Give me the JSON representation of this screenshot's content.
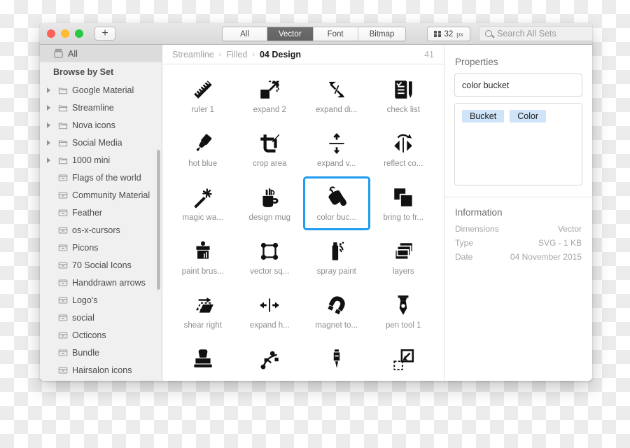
{
  "window": {
    "traffic_lights": [
      {
        "name": "close",
        "color": "#ff5f57"
      },
      {
        "name": "minimize",
        "color": "#febc2e"
      },
      {
        "name": "zoom",
        "color": "#28c840"
      }
    ],
    "add_button_label": "+"
  },
  "toolbar": {
    "segments": [
      {
        "label": "All",
        "active": false
      },
      {
        "label": "Vector",
        "active": true
      },
      {
        "label": "Font",
        "active": false
      },
      {
        "label": "Bitmap",
        "active": false
      }
    ],
    "size_value": "32",
    "size_unit": "px",
    "search_placeholder": "Search All Sets",
    "accent_color": "#1f9cf0"
  },
  "sidebar": {
    "all_label": "All",
    "section_header": "Browse by Set",
    "expandable": [
      {
        "label": "Google Material"
      },
      {
        "label": "Streamline"
      },
      {
        "label": "Nova icons"
      },
      {
        "label": "Social Media"
      },
      {
        "label": "1000 mini"
      }
    ],
    "sets": [
      {
        "label": "Flags of the world"
      },
      {
        "label": "Community Material"
      },
      {
        "label": "Feather"
      },
      {
        "label": "os-x-cursors"
      },
      {
        "label": "Picons"
      },
      {
        "label": "70 Social Icons"
      },
      {
        "label": "Handdrawn arrows"
      },
      {
        "label": "Logo's"
      },
      {
        "label": "social"
      },
      {
        "label": "Octicons"
      },
      {
        "label": "Bundle"
      },
      {
        "label": "Hairsalon icons"
      }
    ]
  },
  "breadcrumb": {
    "parts": [
      "Streamline",
      "Filled",
      "04 Design"
    ],
    "separator": "›",
    "count": "41"
  },
  "grid": {
    "icons": [
      {
        "caption": "ruler 1",
        "glyph": "ruler-icon",
        "selected": false
      },
      {
        "caption": "expand 2",
        "glyph": "expand-2-icon",
        "selected": false
      },
      {
        "caption": "expand di...",
        "glyph": "expand-diagonal-icon",
        "selected": false
      },
      {
        "caption": "check list",
        "glyph": "check-list-icon",
        "selected": false
      },
      {
        "caption": "hot blue",
        "glyph": "hot-blue-icon",
        "selected": false
      },
      {
        "caption": "crop area",
        "glyph": "crop-area-icon",
        "selected": false
      },
      {
        "caption": "expand v...",
        "glyph": "expand-vertical-icon",
        "selected": false
      },
      {
        "caption": "reflect co...",
        "glyph": "reflect-icon",
        "selected": false
      },
      {
        "caption": "magic wa...",
        "glyph": "magic-wand-icon",
        "selected": false
      },
      {
        "caption": "design mug",
        "glyph": "design-mug-icon",
        "selected": false
      },
      {
        "caption": "color buc...",
        "glyph": "color-bucket-icon",
        "selected": true
      },
      {
        "caption": "bring to fr...",
        "glyph": "bring-to-front-icon",
        "selected": false
      },
      {
        "caption": "paint brus...",
        "glyph": "paint-brush-icon",
        "selected": false
      },
      {
        "caption": "vector sq...",
        "glyph": "vector-square-icon",
        "selected": false
      },
      {
        "caption": "spray paint",
        "glyph": "spray-paint-icon",
        "selected": false
      },
      {
        "caption": "layers",
        "glyph": "layers-icon",
        "selected": false
      },
      {
        "caption": "shear right",
        "glyph": "shear-right-icon",
        "selected": false
      },
      {
        "caption": "expand h...",
        "glyph": "expand-horizontal-icon",
        "selected": false
      },
      {
        "caption": "magnet to...",
        "glyph": "magnet-icon",
        "selected": false
      },
      {
        "caption": "pen tool 1",
        "glyph": "pen-tool-icon",
        "selected": false
      },
      {
        "caption": "",
        "glyph": "stamp-icon",
        "selected": false
      },
      {
        "caption": "",
        "glyph": "bezier-node-icon",
        "selected": false
      },
      {
        "caption": "",
        "glyph": "eyedropper-icon",
        "selected": false
      },
      {
        "caption": "",
        "glyph": "send-to-back-icon",
        "selected": false
      }
    ]
  },
  "properties": {
    "title": "Properties",
    "name_value": "color bucket",
    "tags": [
      "Bucket",
      "Color"
    ],
    "tag_color": "#cfe4f9"
  },
  "information": {
    "title": "Information",
    "rows": [
      {
        "label": "Dimensions",
        "value": "Vector"
      },
      {
        "label": "Type",
        "value": "SVG - 1 KB"
      },
      {
        "label": "Date",
        "value": "04 November 2015"
      }
    ]
  }
}
